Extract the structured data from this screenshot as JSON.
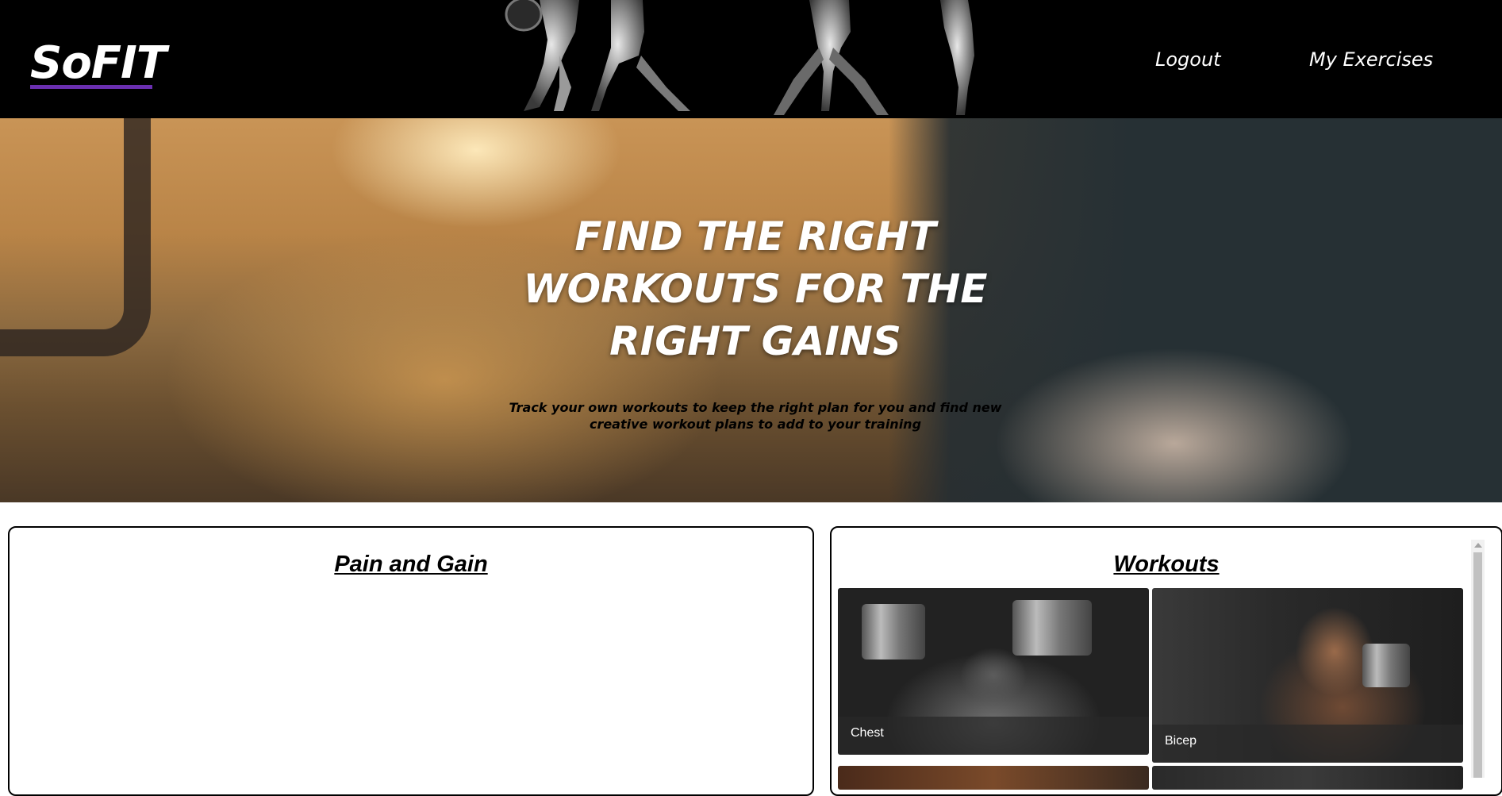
{
  "header": {
    "logo": "SoFIT",
    "nav": {
      "logout": "Logout",
      "my_exercises": "My Exercises"
    }
  },
  "hero": {
    "title": "FIND THE RIGHT WORKOUTS FOR THE RIGHT GAINS",
    "subtitle": "Track your own workouts to keep the right plan for you and find new creative workout plans to add to your training"
  },
  "panels": {
    "left": {
      "title": "Pain and Gain"
    },
    "right": {
      "title": "Workouts",
      "cards": [
        {
          "label": "Chest"
        },
        {
          "label": "Bicep"
        }
      ]
    }
  },
  "colors": {
    "logo_underline": "#6a2fb0",
    "header_bg": "#000000"
  }
}
